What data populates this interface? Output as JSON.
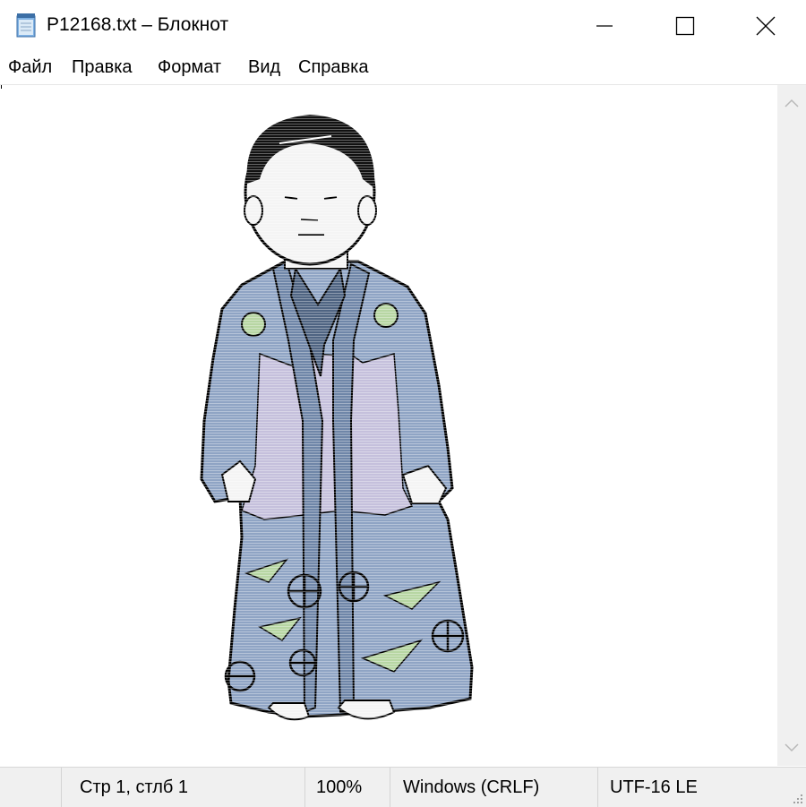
{
  "window": {
    "title": "P12168.txt – Блокнот",
    "icon": "notepad-icon"
  },
  "controls": {
    "minimize": "minimize-icon",
    "maximize": "maximize-icon",
    "close": "close-icon"
  },
  "menu": {
    "items": [
      {
        "label": "Файл"
      },
      {
        "label": "Правка"
      },
      {
        "label": "Формат"
      },
      {
        "label": "Вид"
      },
      {
        "label": "Справка"
      }
    ]
  },
  "editor": {
    "content": "ASCII-art illustration: child in kimono",
    "colors": {
      "kimono": "#8fa4c4",
      "kimono_shadow": "#6f86a8",
      "inner_panel": "#c5c0dc",
      "leaves": "#b7d6a3",
      "skin": "#f4f4f4",
      "hair": "#111111"
    }
  },
  "status": {
    "position": "Стр 1, стлб 1",
    "zoom": "100%",
    "line_endings": "Windows (CRLF)",
    "encoding": "UTF-16 LE"
  }
}
